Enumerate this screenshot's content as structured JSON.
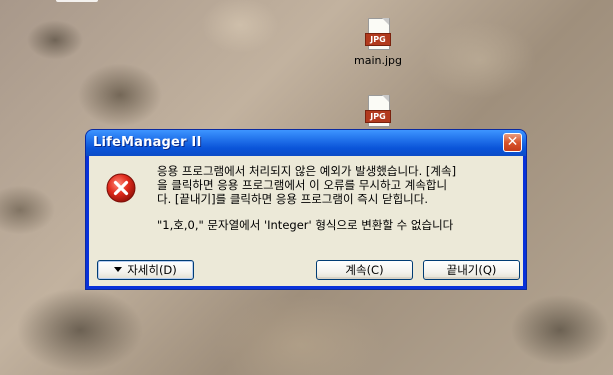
{
  "desktop": {
    "icons": [
      {
        "badge": "JPG",
        "label": "main.jpg"
      },
      {
        "badge": "JPG",
        "label": ""
      }
    ]
  },
  "dialog": {
    "title": "LifeManager II",
    "close_glyph": "✕",
    "icon": "error-x-icon",
    "message_lines": [
      "응용 프로그램에서 처리되지 않은 예외가 발생했습니다. [계속]",
      "을 클릭하면 응용 프로그램에서 이 오류를 무시하고 계속합니",
      "다. [끝내기]를 클릭하면 응용 프로그램이 즉시 닫힙니다."
    ],
    "detail": "\"1,호,0,\" 문자열에서 'Integer' 형식으로 변환할 수 없습니다",
    "buttons": {
      "details": "자세히(D)",
      "continue": "계속(C)",
      "quit": "끝내기(Q)"
    }
  },
  "colors": {
    "title_blue": "#0a54d9",
    "client_bg": "#ece9d8",
    "close_red": "#d9542b",
    "error_red": "#e02a1c"
  }
}
